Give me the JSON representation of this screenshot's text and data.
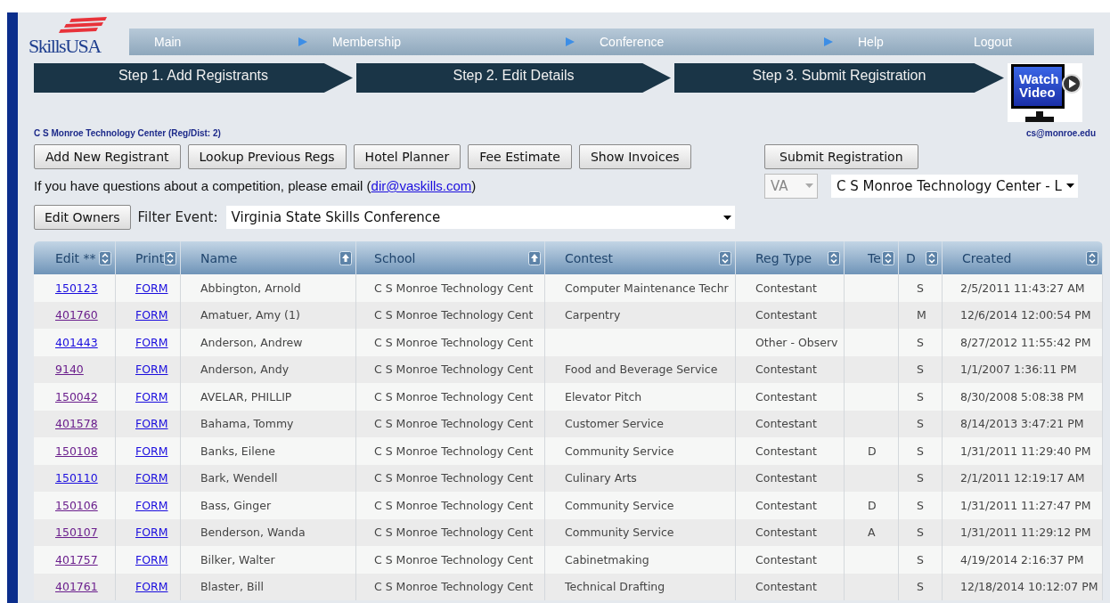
{
  "logo": {
    "text": "SkillsUSA"
  },
  "nav": [
    {
      "label": "Main",
      "separator": true
    },
    {
      "label": "Membership",
      "separator": true
    },
    {
      "label": "Conference",
      "separator": true
    },
    {
      "label": "Help",
      "separator": false
    },
    {
      "label": "Logout",
      "separator": false
    }
  ],
  "steps": [
    "Step 1. Add Registrants",
    "Step 2. Edit Details",
    "Step 3. Submit Registration"
  ],
  "video_button": {
    "label": "Watch Video"
  },
  "organization": "C S Monroe Technology Center (Reg/Dist: 2)",
  "user_email": "cs@monroe.edu",
  "buttons": [
    "Add New Registrant",
    "Lookup Previous Regs",
    "Hotel Planner",
    "Fee Estimate",
    "Show Invoices"
  ],
  "submit_button": "Submit Registration",
  "info": {
    "text": "If you have questions about a competition, please email (",
    "link": "dir@vaskills.com",
    "end": ")"
  },
  "state_select": {
    "value": "VA",
    "disabled": true
  },
  "school_select": {
    "value": "C S Monroe Technology Center - L",
    "disabled": false
  },
  "edit_owners_button": "Edit Owners",
  "filter": {
    "label": "Filter Event:",
    "value": "Virginia State Skills Conference"
  },
  "table": {
    "columns": [
      {
        "label": "Edit **",
        "sorted": false
      },
      {
        "label": "Print",
        "sorted": false
      },
      {
        "label": "Name",
        "sorted": true
      },
      {
        "label": "School",
        "sorted": true
      },
      {
        "label": "Contest",
        "sorted": false
      },
      {
        "label": "Reg Type",
        "sorted": false
      },
      {
        "label": "Te",
        "sorted": false
      },
      {
        "label": "D",
        "sorted": false
      },
      {
        "label": "Created",
        "sorted": false
      }
    ],
    "rows": [
      {
        "id": "150123",
        "id_visited": false,
        "print": "FORM",
        "name": "Abbington, Arnold",
        "school": "C S Monroe Technology Cent",
        "contest": "Computer Maintenance Techr",
        "reg_type": "Contestant",
        "team": "",
        "d": "S",
        "created": "2/5/2011 11:43:27 AM"
      },
      {
        "id": "401760",
        "id_visited": true,
        "print": "FORM",
        "name": "Amatuer, Amy (1)",
        "school": "C S Monroe Technology Cent",
        "contest": "Carpentry",
        "reg_type": "Contestant",
        "team": "",
        "d": "M",
        "created": "12/6/2014 12:00:54 PM"
      },
      {
        "id": "401443",
        "id_visited": false,
        "print": "FORM",
        "name": "Anderson, Andrew",
        "school": "C S Monroe Technology Cent",
        "contest": "",
        "reg_type": "Other - Observ",
        "team": "",
        "d": "S",
        "created": "8/27/2012 11:55:42 PM"
      },
      {
        "id": "9140",
        "id_visited": true,
        "print": "FORM",
        "name": "Anderson, Andy",
        "school": "C S Monroe Technology Cent",
        "contest": "Food and Beverage Service",
        "reg_type": "Contestant",
        "team": "",
        "d": "S",
        "created": "1/1/2007 1:36:11 PM"
      },
      {
        "id": "150042",
        "id_visited": true,
        "print": "FORM",
        "name": "AVELAR, PHILLIP",
        "school": "C S Monroe Technology Cent",
        "contest": "Elevator Pitch",
        "reg_type": "Contestant",
        "team": "",
        "d": "S",
        "created": "8/30/2008 5:08:38 PM"
      },
      {
        "id": "401578",
        "id_visited": true,
        "print": "FORM",
        "name": "Bahama, Tommy",
        "school": "C S Monroe Technology Cent",
        "contest": "Customer Service",
        "reg_type": "Contestant",
        "team": "",
        "d": "S",
        "created": "8/14/2013 3:47:21 PM"
      },
      {
        "id": "150108",
        "id_visited": true,
        "print": "FORM",
        "name": "Banks, Eilene",
        "school": "C S Monroe Technology Cent",
        "contest": "Community Service",
        "reg_type": "Contestant",
        "team": "D",
        "d": "S",
        "created": "1/31/2011 11:29:40 PM"
      },
      {
        "id": "150110",
        "id_visited": false,
        "print": "FORM",
        "name": "Bark, Wendell",
        "school": "C S Monroe Technology Cent",
        "contest": "Culinary Arts",
        "reg_type": "Contestant",
        "team": "",
        "d": "S",
        "created": "2/1/2011 12:19:17 AM"
      },
      {
        "id": "150106",
        "id_visited": true,
        "print": "FORM",
        "name": "Bass, Ginger",
        "school": "C S Monroe Technology Cent",
        "contest": "Community Service",
        "reg_type": "Contestant",
        "team": "D",
        "d": "S",
        "created": "1/31/2011 11:27:47 PM"
      },
      {
        "id": "150107",
        "id_visited": true,
        "print": "FORM",
        "name": "Benderson, Wanda",
        "school": "C S Monroe Technology Cent",
        "contest": "Community Service",
        "reg_type": "Contestant",
        "team": "A",
        "d": "S",
        "created": "1/31/2011 11:29:12 PM"
      },
      {
        "id": "401757",
        "id_visited": true,
        "print": "FORM",
        "name": "Bilker, Walter",
        "school": "C S Monroe Technology Cent",
        "contest": "Cabinetmaking",
        "reg_type": "Contestant",
        "team": "",
        "d": "S",
        "created": "4/19/2014 2:16:37 PM"
      },
      {
        "id": "401761",
        "id_visited": true,
        "print": "FORM",
        "name": "Blaster, Bill",
        "school": "C S Monroe Technology Cent",
        "contest": "Technical Drafting",
        "reg_type": "Contestant",
        "team": "",
        "d": "S",
        "created": "12/18/2014 10:12:07 PM"
      }
    ]
  }
}
